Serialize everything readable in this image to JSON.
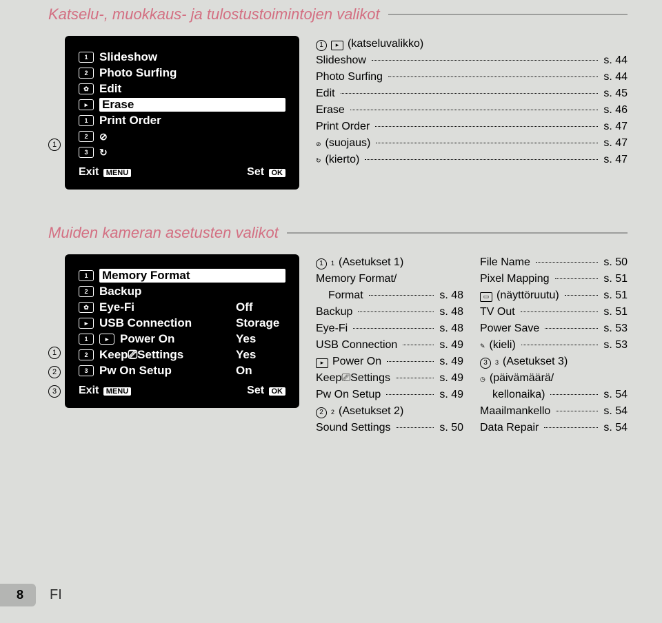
{
  "section1": {
    "title": "Katselu-, muokkaus- ja tulostustoimintojen valikot",
    "screen": {
      "items": [
        {
          "iconName": "camera1-icon",
          "iconText": "1",
          "label": "Slideshow"
        },
        {
          "iconName": "camera2-icon",
          "iconText": "2",
          "label": "Photo Surfing"
        },
        {
          "iconName": "movie-icon",
          "iconText": "✿",
          "label": "Edit"
        },
        {
          "iconName": "play-icon",
          "iconText": "▸",
          "label": "Erase",
          "highlight": true
        },
        {
          "iconName": "wrench1-icon",
          "iconText": "1",
          "label": "Print Order"
        },
        {
          "iconName": "wrench2-icon",
          "iconText": "2",
          "label": "",
          "glyph": "protect-icon",
          "glyphChar": "⊘"
        },
        {
          "iconName": "wrench3-icon",
          "iconText": "3",
          "label": "",
          "glyph": "rotate-icon",
          "glyphChar": "↻"
        }
      ],
      "exit": "Exit",
      "exitKey": "MENU",
      "set": "Set",
      "setKey": "OK"
    },
    "markers": [
      "1"
    ],
    "list": {
      "header": {
        "circle": "1",
        "iconText": "▸",
        "iconName": "play-icon",
        "label": "(katseluvalikko)"
      },
      "entries": [
        {
          "label": "Slideshow",
          "page": "s. 44"
        },
        {
          "label": "Photo Surfing",
          "page": "s. 44"
        },
        {
          "label": "Edit",
          "page": "s. 45"
        },
        {
          "label": "Erase",
          "page": "s. 46"
        },
        {
          "label": "Print Order",
          "page": "s. 47"
        },
        {
          "glyphName": "protect-icon",
          "glyphChar": "⊘",
          "label": "(suojaus)",
          "page": "s. 47"
        },
        {
          "glyphName": "rotate-icon",
          "glyphChar": "↻",
          "label": "(kierto)",
          "page": "s. 47"
        }
      ]
    }
  },
  "section2": {
    "title": "Muiden kameran asetusten valikot",
    "screen": {
      "items": [
        {
          "iconName": "camera1-icon",
          "iconText": "1",
          "label": "Memory Format",
          "highlight": true
        },
        {
          "iconName": "camera2-icon",
          "iconText": "2",
          "label": "Backup"
        },
        {
          "iconName": "movie-icon",
          "iconText": "✿",
          "label": "Eye-Fi",
          "value": "Off"
        },
        {
          "iconName": "play-icon",
          "iconText": "▸",
          "label": "USB Connection",
          "value": "Storage"
        },
        {
          "iconName": "wrench1-icon",
          "iconText": "1",
          "label": "Power On",
          "prefixGlyph": "▸",
          "prefixName": "play-icon",
          "value": "Yes"
        },
        {
          "iconName": "wrench2-icon",
          "iconText": "2",
          "label": "Keep⎚Settings",
          "value": "Yes"
        },
        {
          "iconName": "wrench3-icon",
          "iconText": "3",
          "label": "Pw On Setup",
          "value": "On"
        }
      ],
      "exit": "Exit",
      "exitKey": "MENU",
      "set": "Set",
      "setKey": "OK"
    },
    "markers": [
      "1",
      "2",
      "3"
    ],
    "cols": [
      [
        {
          "circle": "1",
          "glyphName": "wrench1-icon",
          "glyphChar": "1",
          "label": "(Asetukset 1)"
        },
        {
          "label": "Memory Format/"
        },
        {
          "label": "Format",
          "page": "s. 48",
          "sub": true
        },
        {
          "label": "Backup",
          "page": "s. 48"
        },
        {
          "label": "Eye-Fi",
          "page": "s. 48"
        },
        {
          "label": "USB Connection",
          "page": "s. 49"
        },
        {
          "glyphName": "play-icon",
          "glyphChar": "▸",
          "boxed": true,
          "label": "Power On",
          "page": "s. 49"
        },
        {
          "label": "Keep⎚Settings",
          "page": "s. 49"
        },
        {
          "label": "Pw On Setup",
          "page": "s. 49"
        },
        {
          "circle": "2",
          "glyphName": "wrench2-icon",
          "glyphChar": "2",
          "label": "(Asetukset 2)"
        },
        {
          "label": "Sound Settings",
          "page": "s. 50"
        }
      ],
      [
        {
          "label": "File Name",
          "page": "s. 50"
        },
        {
          "label": "Pixel Mapping",
          "page": "s. 51"
        },
        {
          "glyphName": "monitor-icon",
          "glyphChar": "▭",
          "boxed": true,
          "label": "(näyttöruutu)",
          "page": "s. 51"
        },
        {
          "label": "TV Out",
          "page": "s. 51"
        },
        {
          "label": "Power Save",
          "page": "s. 53"
        },
        {
          "glyphName": "language-icon",
          "glyphChar": "✎",
          "label": "(kieli)",
          "page": "s. 53"
        },
        {
          "circle": "3",
          "glyphName": "wrench3-icon",
          "glyphChar": "3",
          "label": "(Asetukset 3)"
        },
        {
          "glyphName": "clock-icon",
          "glyphChar": "◷",
          "label": "(päivämäärä/"
        },
        {
          "label": "kellonaika)",
          "page": "s. 54",
          "sub": true
        },
        {
          "label": "Maailmankello",
          "page": "s. 54"
        },
        {
          "label": "Data Repair",
          "page": "s. 54"
        }
      ]
    ]
  },
  "footer": {
    "page": "8",
    "lang": "FI"
  }
}
